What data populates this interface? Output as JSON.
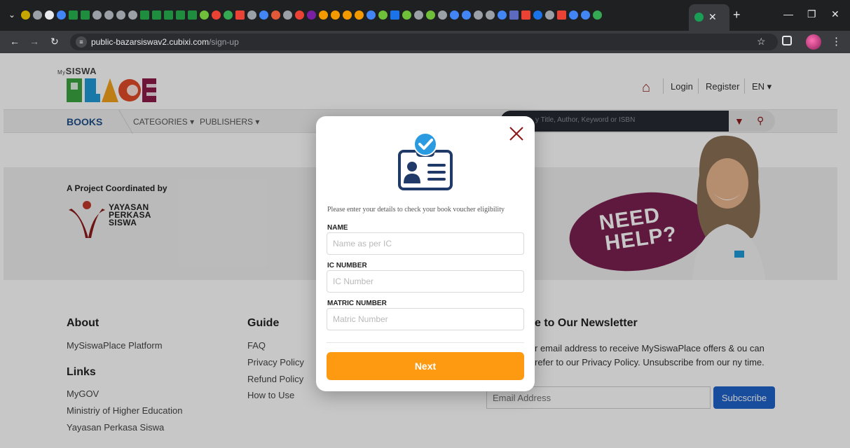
{
  "browser": {
    "url_host": "public-bazarsiswav2.cubixi.com",
    "url_path": "/sign-up",
    "site_icon": "≡"
  },
  "colors": {
    "brand_red": "#8d1a1a",
    "brand_blue": "#1f4f8a",
    "accent_orange": "#fd9a12",
    "subscribe_blue": "#1f63c9",
    "help_purple": "#7b2150"
  },
  "header": {
    "logo_prefix": "My",
    "logo_name": "SISWA",
    "login_label": "Login",
    "register_label": "Register",
    "language_label": "EN ▾"
  },
  "nav": {
    "books_label": "BOOKS",
    "categories_label": "CATEGORIES ▾",
    "publishers_label": "PUBLISHERS ▾",
    "search_placeholder": "y Title, Author, Keyword or ISBN"
  },
  "banner": {
    "project_label": "A Project Coordinated by",
    "partner_line1": "YAYASAN",
    "partner_line2": "PERKASA",
    "partner_line3": "SISWA",
    "help_line1": "NEED",
    "help_line2": "HELP?"
  },
  "footer": {
    "about_heading": "About",
    "about_link": "MySiswaPlace Platform",
    "links_heading": "Links",
    "links": [
      "MyGOV",
      "Ministriy of Higher Education",
      "Yayasan Perkasa Siswa"
    ],
    "guide_heading": "Guide",
    "guide_links": [
      "FAQ",
      "Privacy Policy",
      "Refund Policy",
      "How to Use"
    ],
    "newsletter_heading": "e to Our Newsletter",
    "newsletter_text": "r email address to receive MySiswaPlace offers & ou can refer to our Privacy Policy. Unsubscribe from our ny time.",
    "email_placeholder": "Email Address",
    "subscribe_label": "Subcscribe"
  },
  "modal": {
    "intro": "Please enter your details to check your book voucher eligibility",
    "name_label": "NAME",
    "name_placeholder": "Name as per IC",
    "ic_label": "IC NUMBER",
    "ic_placeholder": "IC Number",
    "matric_label": "MATRIC NUMBER",
    "matric_placeholder": "Matric Number",
    "next_label": "Next"
  }
}
